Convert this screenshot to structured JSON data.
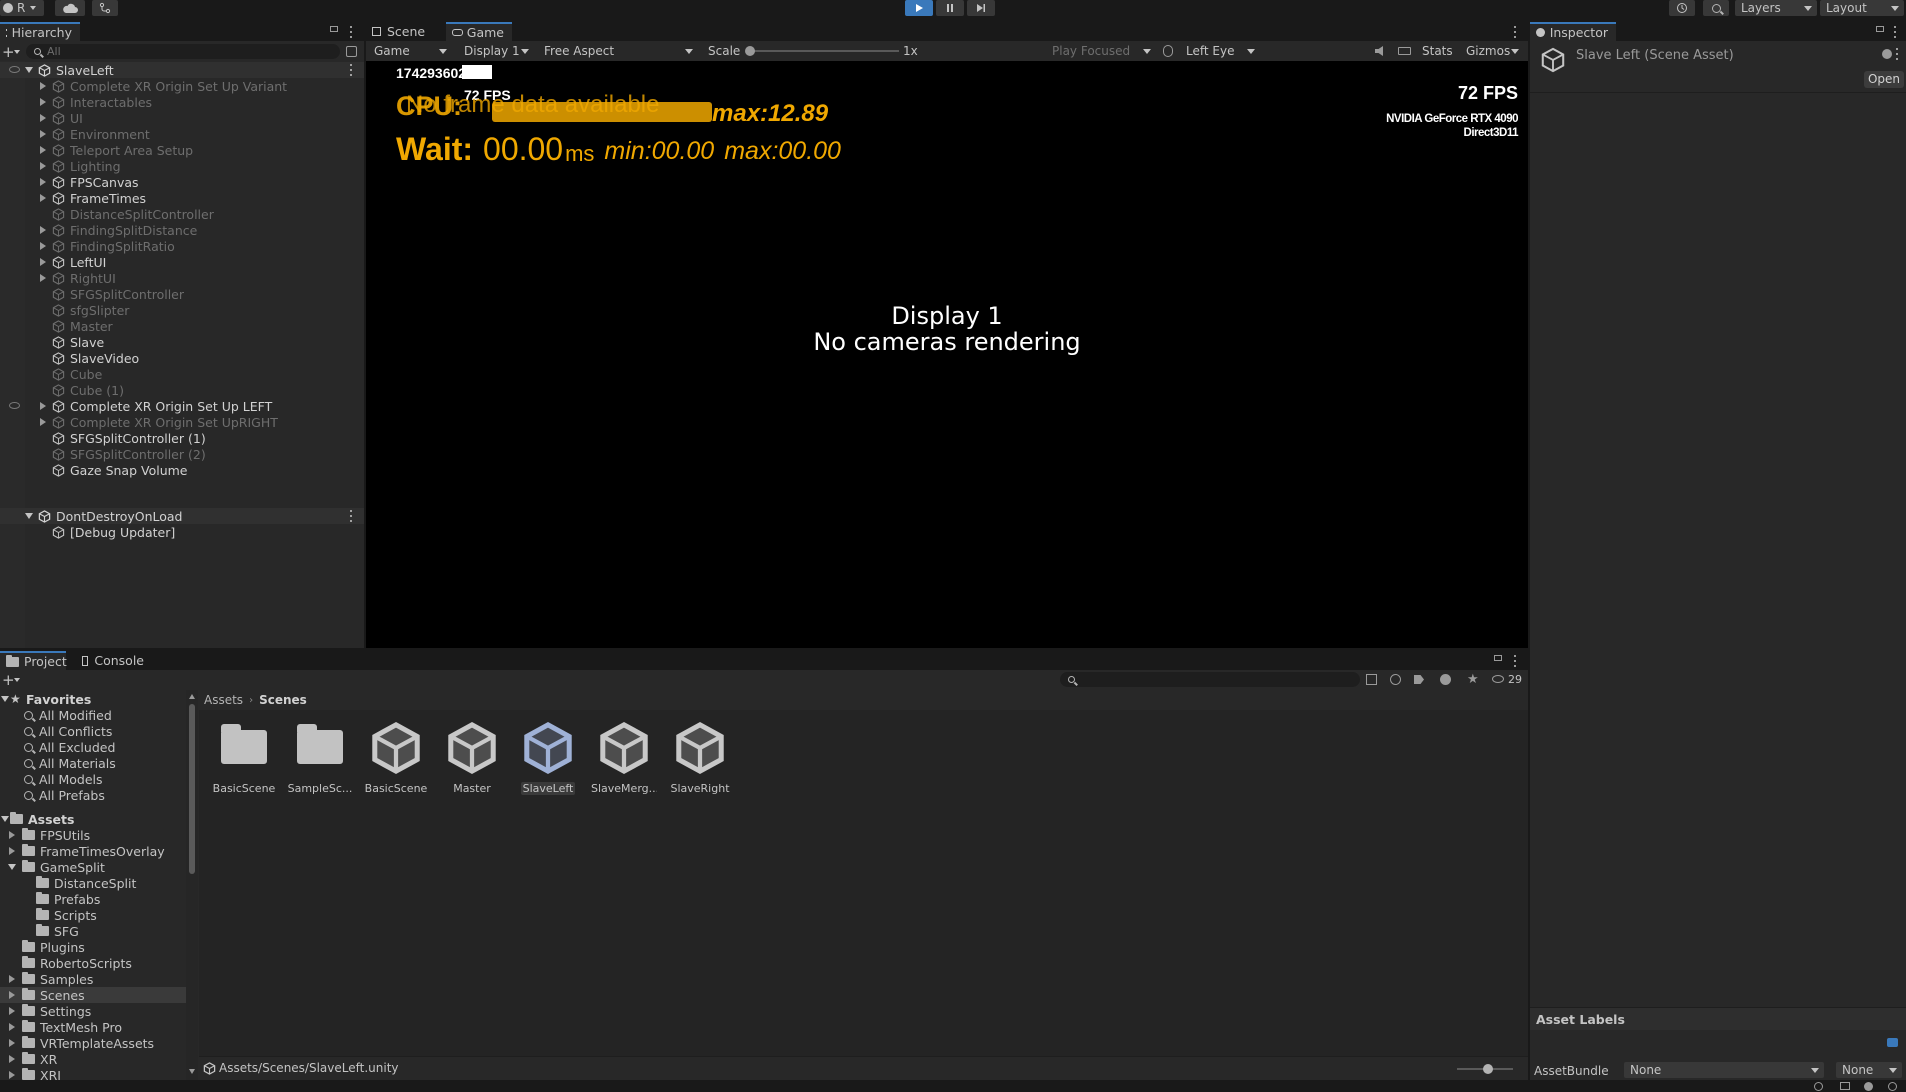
{
  "toolbar": {
    "account_label": "R",
    "layers_label": "Layers",
    "layout_label": "Layout"
  },
  "hierarchy": {
    "tab_label": "Hierarchy",
    "search_placeholder": "All",
    "scene_name": "SlaveLeft",
    "items": [
      {
        "label": "Complete XR Origin Set Up Variant",
        "dim": true,
        "arrow": true
      },
      {
        "label": "Interactables",
        "dim": true,
        "arrow": true
      },
      {
        "label": "UI",
        "dim": true,
        "arrow": true
      },
      {
        "label": "Environment",
        "dim": true,
        "arrow": true
      },
      {
        "label": "Teleport Area Setup",
        "dim": true,
        "arrow": true
      },
      {
        "label": "Lighting",
        "dim": true,
        "arrow": true
      },
      {
        "label": "FPSCanvas",
        "dim": false,
        "arrow": true
      },
      {
        "label": "FrameTimes",
        "dim": false,
        "arrow": true
      },
      {
        "label": "DistanceSplitController",
        "dim": true,
        "arrow": false
      },
      {
        "label": "FindingSplitDistance",
        "dim": true,
        "arrow": true
      },
      {
        "label": "FindingSplitRatio",
        "dim": true,
        "arrow": true
      },
      {
        "label": "LeftUI",
        "dim": false,
        "arrow": true
      },
      {
        "label": "RightUI",
        "dim": true,
        "arrow": true
      },
      {
        "label": "SFGSplitController",
        "dim": true,
        "arrow": false
      },
      {
        "label": "sfgSlipter",
        "dim": true,
        "arrow": false
      },
      {
        "label": "Master",
        "dim": true,
        "arrow": false
      },
      {
        "label": "Slave",
        "dim": false,
        "arrow": false
      },
      {
        "label": "SlaveVideo",
        "dim": false,
        "arrow": false
      },
      {
        "label": "Cube",
        "dim": true,
        "arrow": false
      },
      {
        "label": "Cube (1)",
        "dim": true,
        "arrow": false
      },
      {
        "label": "Complete XR Origin Set Up LEFT",
        "dim": false,
        "arrow": true
      },
      {
        "label": "Complete XR Origin Set UpRIGHT",
        "dim": true,
        "arrow": true
      },
      {
        "label": "SFGSplitController (1)",
        "dim": false,
        "arrow": false
      },
      {
        "label": "SFGSplitController (2)",
        "dim": true,
        "arrow": false
      },
      {
        "label": "Gaze Snap Volume",
        "dim": false,
        "arrow": false
      }
    ],
    "dontdestroy_label": "DontDestroyOnLoad",
    "debug_updater_label": "[Debug Updater]"
  },
  "game": {
    "tab_scene": "Scene",
    "tab_game": "Game",
    "mode_select": "Game",
    "display_select": "Display 1",
    "aspect_select": "Free Aspect",
    "scale_label": "Scale",
    "scale_value": "1x",
    "play_focused": "Play Focused",
    "eye_select": "Left Eye",
    "stats_label": "Stats",
    "gizmos_label": "Gizmos",
    "display_message_line1": "Display 1",
    "display_message_line2": "No cameras rendering",
    "overlay": {
      "timestamp": "174293602",
      "fps_small": "72 FPS",
      "garbled_line": "No frame data available",
      "cpu_label": "CPU:",
      "cpu_extra": "max:12.89",
      "wait_label": "Wait:",
      "wait_value": "00.00",
      "wait_unit": "ms",
      "wait_min": "min:00.00",
      "wait_max": "max:00.00",
      "fps_right": "72 FPS",
      "gpu_name": "NVIDIA GeForce RTX 4090",
      "api_name": "Direct3D11"
    }
  },
  "inspector": {
    "tab_label": "Inspector",
    "title": "Slave Left (Scene Asset)",
    "open_button": "Open",
    "asset_labels_title": "Asset Labels",
    "assetbundle_label": "AssetBundle",
    "assetbundle_value": "None",
    "assetbundle_variant": "None"
  },
  "project": {
    "tab_project": "Project",
    "tab_console": "Console",
    "hidden_count": "29",
    "favorites_label": "Favorites",
    "favorites": [
      "All Modified",
      "All Conflicts",
      "All Excluded",
      "All Materials",
      "All Models",
      "All Prefabs"
    ],
    "assets_label": "Assets",
    "tree": [
      {
        "label": "FPSUtils",
        "level": 1,
        "arrow": "right"
      },
      {
        "label": "FrameTimesOverlay",
        "level": 1,
        "arrow": "right"
      },
      {
        "label": "GameSplit",
        "level": 1,
        "arrow": "down"
      },
      {
        "label": "DistanceSplit",
        "level": 2,
        "arrow": "none"
      },
      {
        "label": "Prefabs",
        "level": 2,
        "arrow": "none"
      },
      {
        "label": "Scripts",
        "level": 2,
        "arrow": "none"
      },
      {
        "label": "SFG",
        "level": 2,
        "arrow": "none"
      },
      {
        "label": "Plugins",
        "level": 1,
        "arrow": "none"
      },
      {
        "label": "RobertoScripts",
        "level": 1,
        "arrow": "none"
      },
      {
        "label": "Samples",
        "level": 1,
        "arrow": "right"
      },
      {
        "label": "Scenes",
        "level": 1,
        "arrow": "right",
        "selected": true
      },
      {
        "label": "Settings",
        "level": 1,
        "arrow": "right"
      },
      {
        "label": "TextMesh Pro",
        "level": 1,
        "arrow": "right"
      },
      {
        "label": "VRTemplateAssets",
        "level": 1,
        "arrow": "right"
      },
      {
        "label": "XR",
        "level": 1,
        "arrow": "right"
      },
      {
        "label": "XRI",
        "level": 1,
        "arrow": "right"
      }
    ],
    "breadcrumb_root": "Assets",
    "breadcrumb_current": "Scenes",
    "assets": [
      {
        "label": "BasicScene",
        "kind": "folder"
      },
      {
        "label": "SampleSc...",
        "kind": "folder"
      },
      {
        "label": "BasicScene",
        "kind": "scene"
      },
      {
        "label": "Master",
        "kind": "scene"
      },
      {
        "label": "SlaveLeft",
        "kind": "scene",
        "selected": true
      },
      {
        "label": "SlaveMerg...",
        "kind": "scene"
      },
      {
        "label": "SlaveRight",
        "kind": "scene"
      }
    ],
    "status_path": "Assets/Scenes/SlaveLeft.unity"
  },
  "colors": {
    "accent_blue": "#3a79bb",
    "overlay_orange": "#f0a800",
    "play_active": "#4a7fcf"
  }
}
